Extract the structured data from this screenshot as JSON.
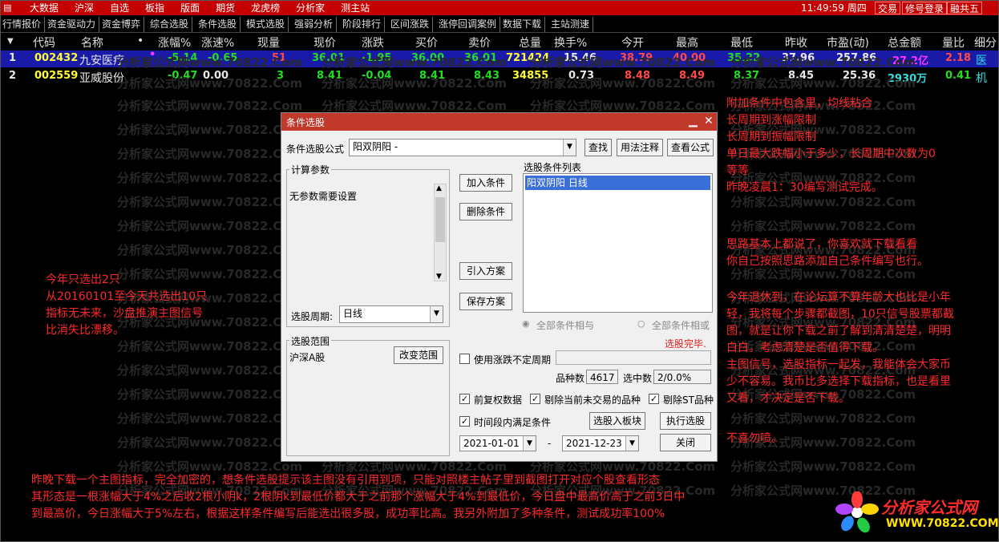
{
  "topbar": {
    "menu": [
      "大数据",
      "沪深",
      "自选",
      "板指",
      "版面",
      "期货",
      "龙虎榜",
      "分析家",
      "测主站"
    ],
    "time": "11:49:59 周四",
    "buttons": [
      "交易",
      "修号登录",
      "融共五"
    ]
  },
  "tabs": [
    "行情报价",
    "资金驱动力",
    "资金博弈",
    "综合选股",
    "条件选股",
    "模式选股",
    "强弱分析",
    "阶段排行",
    "区间涨跌",
    "涨停回调案例",
    "数据下载",
    "主站测速"
  ],
  "table": {
    "headers": [
      "代码",
      "名称",
      "•",
      "涨幅%",
      "涨速%",
      "现量",
      "现价",
      "涨跌",
      "买价",
      "卖价",
      "总量",
      "换手%",
      "今开",
      "最高",
      "最低",
      "昨收",
      "市盈(动)",
      "总金额",
      "量比",
      "细分"
    ],
    "rows": [
      {
        "idx": "1",
        "code": "002432",
        "name": "九安医疗",
        "dot": "•",
        "chg_pct": "-5.14",
        "speed": "-0.65",
        "vol_now": "51",
        "price": "36.01",
        "chg": "-1.95",
        "bid": "36.00",
        "ask": "36.01",
        "vol": "721424",
        "turnover": "15.46",
        "open": "38.79",
        "high": "40.00",
        "low": "35.22",
        "prev": "37.96",
        "pe": "257.86",
        "amount": "27.2亿",
        "ratio": "2.18",
        "sector": "医"
      },
      {
        "idx": "2",
        "code": "002559",
        "name": "亚威股份",
        "dot": "",
        "chg_pct": "-0.47",
        "speed": "0.00",
        "vol_now": "3",
        "price": "8.41",
        "chg": "-0.04",
        "bid": "8.41",
        "ask": "8.43",
        "vol": "34855",
        "turnover": "0.73",
        "open": "8.48",
        "high": "8.49",
        "low": "8.37",
        "prev": "8.45",
        "pe": "25.36",
        "amount": "2930万",
        "ratio": "0.41",
        "sector": "机"
      }
    ]
  },
  "watermark": "分析家公式网www.70822.Com",
  "dialog": {
    "title": "条件选股",
    "formula_label": "条件选股公式",
    "formula_value": "阳双阴阳   -",
    "btn_find": "查找",
    "btn_usage": "用法注释",
    "btn_view": "查看公式",
    "params_group": "计算参数",
    "params_text": "无参数需要设置",
    "period_label": "选股周期:",
    "period_value": "日线",
    "btn_add": "加入条件",
    "btn_delete": "删除条件",
    "btn_import": "引入方案",
    "btn_save": "保存方案",
    "cond_list_label": "选股条件列表",
    "cond_items": [
      "阳双阴阳  日线"
    ],
    "radio_and": "全部条件相与",
    "radio_or": "全部条件相或",
    "done_text": "选股完毕.",
    "range_group": "选股范围",
    "range_value": "沪深A股",
    "btn_change": "改变范围",
    "cb_undetermined": "使用涨跌不定周期",
    "count_label": "品种数",
    "count_value": "4617",
    "selected_label": "选中数",
    "selected_value": "2/0.0%",
    "cb_fq": "前复权数据",
    "cb_exclude_today": "剔除当前未交易的品种",
    "cb_exclude_st": "剔除ST品种",
    "cb_period": "时间段内满足条件",
    "btn_to_block": "选股入板块",
    "btn_run": "执行选股",
    "date_from": "2021-01-01",
    "date_sep": "-",
    "date_to": "2021-12-23",
    "btn_close": "关闭"
  },
  "annotations": {
    "left": [
      "今年只选出2只",
      "从20160101至今天共选出10只",
      "指标无未来，沙盘推演主图信号",
      "比消失比漂移。"
    ],
    "right1": [
      "附加条件中包含里，均线粘合",
      "长周期到涨幅限制",
      "长周期到振幅限制",
      "单日最大跌幅小于多少，长周期中次数为0",
      "等等",
      "昨晚凌晨1：30编写测试完成。"
    ],
    "right2": [
      "思路基本上都说了，你喜欢就下载看看",
      "你自己按照思路添加自己条件编写也行。"
    ],
    "right3": [
      "今年退休到，在论坛算不算年龄大也比是小年",
      "轻，我将每个步骤都截图，10只信号股票都截",
      "图，就是让你下载之前了解到清清楚楚，明明",
      "白白。考虑清楚是否值得下载。",
      "主图信号，选股指标一起发，我能体会大家币",
      "少不容易。我币比多选择下载指标，也是看里",
      "又看，才决定是否下载。"
    ],
    "right4": [
      "不喜勿喷。"
    ],
    "bottom": [
      "昨晚下载一个主图指标，完全加密的，想条件选股提示该主图没有引用到项，只能对照楼主帖子里到截图打开对应个股查看形态",
      "其形态是一根涨幅大于4%之后收2根小阴k，2根阴k到最低价都大于之前那个涨幅大于4%到最低价，今日盘中最高价高于之前3日中",
      "到最高价，今日涨幅大于5%左右，根据这样条件编写后能选出很多股，成功率比高。我另外附加了多种条件，测试成功率100%"
    ]
  },
  "brand": {
    "name": "分析家公式网",
    "url": "WWW.70822.COM"
  }
}
